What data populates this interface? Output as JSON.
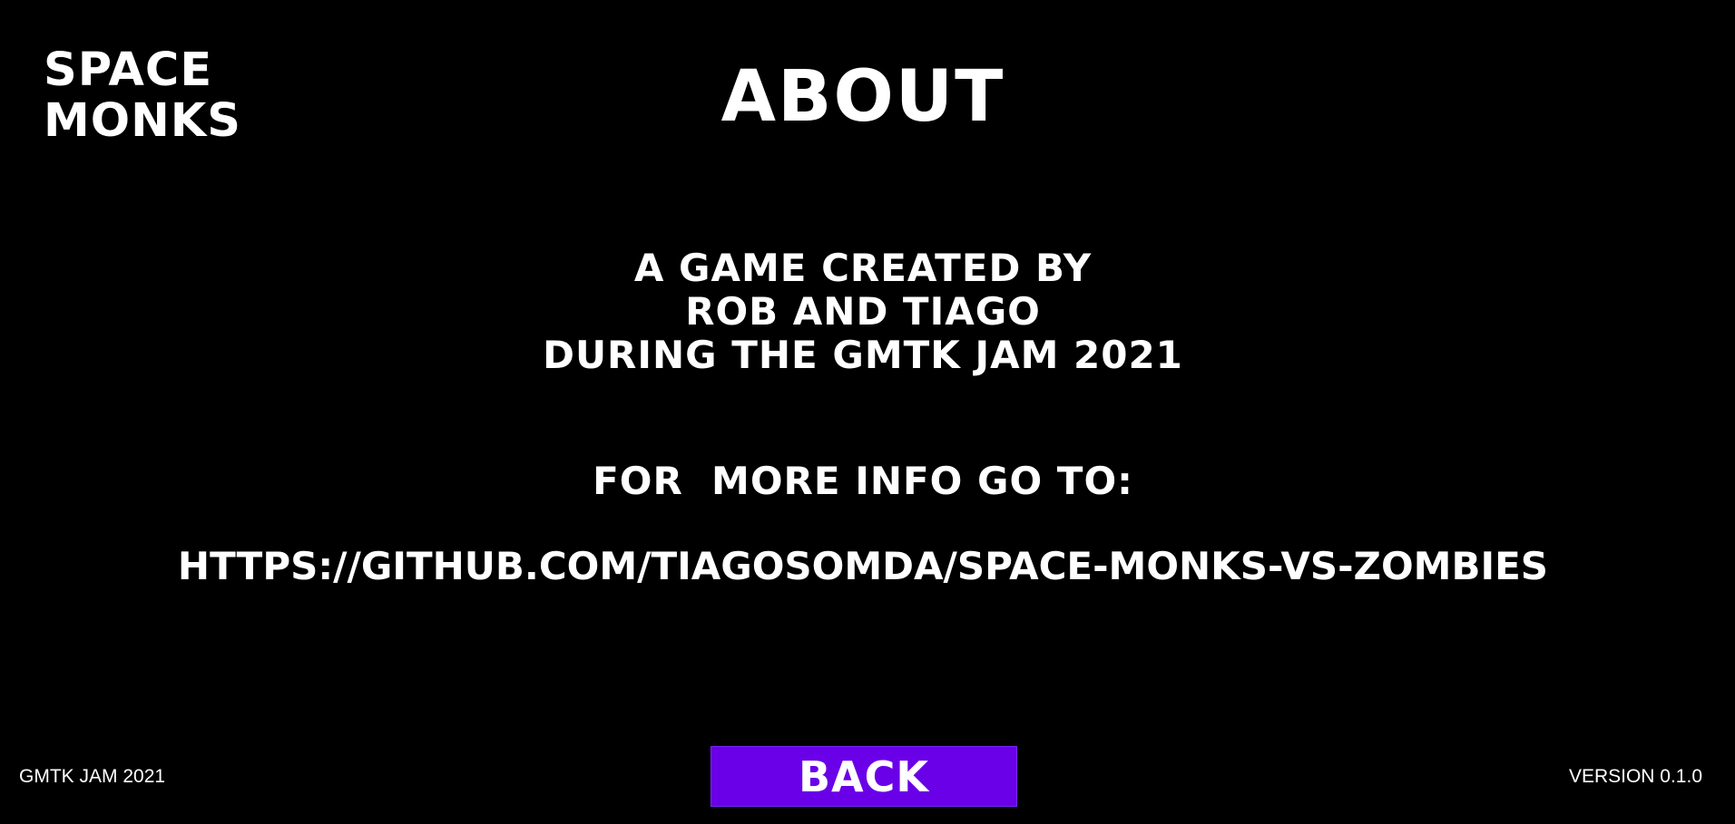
{
  "logo": {
    "line1": "SPACE",
    "line2": "MONKS"
  },
  "screen": {
    "title": "ABOUT"
  },
  "credits": {
    "line1": "A GAME CREATED BY",
    "line2": "ROB AND TIAGO",
    "line3": "DURING THE GMTK JAM 2021"
  },
  "info": {
    "label": "FOR  MORE INFO GO TO:",
    "url": "HTTPS://GITHUB.COM/TIAGOSOMDA/SPACE-MONKS-VS-ZOMBIES"
  },
  "footer": {
    "event": "GMTK JAM 2021",
    "version": "VERSION 0.1.0"
  },
  "buttons": {
    "back_label": "BACK"
  },
  "colors": {
    "background": "#000000",
    "text": "#ffffff",
    "button": "#6a00e8"
  }
}
